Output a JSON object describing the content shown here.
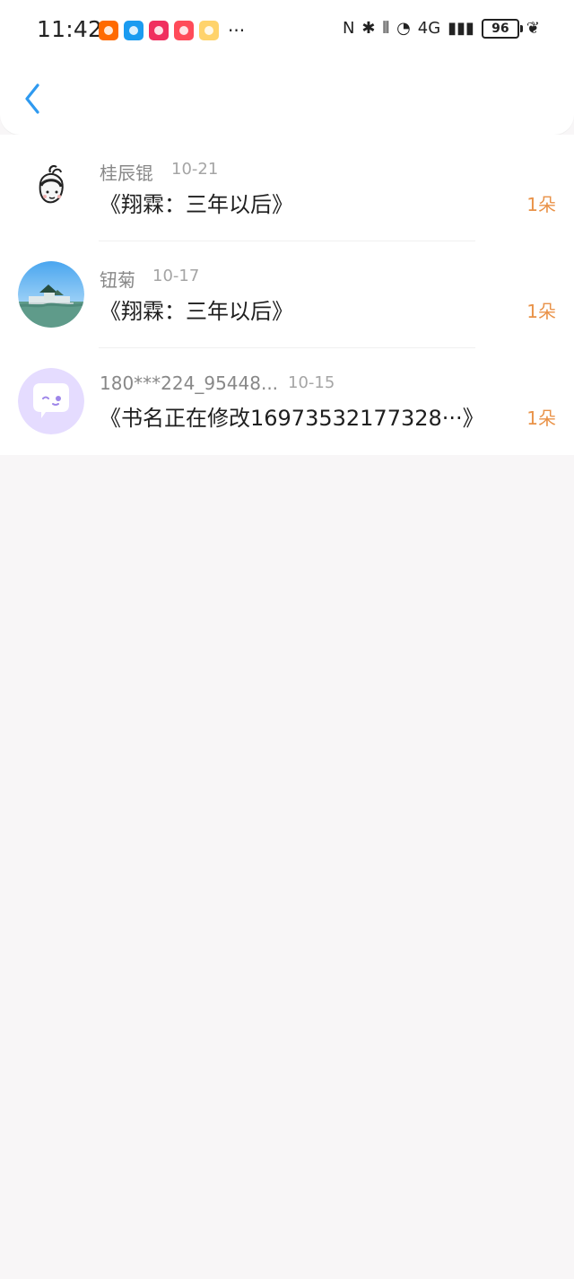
{
  "status_bar": {
    "time": "11:42",
    "more": "···",
    "battery": "96",
    "network": "4G"
  },
  "colors": {
    "accent_blue": "#2f9af0",
    "count_orange": "#e99248",
    "page_bg": "#f8f6f7"
  },
  "icons": {
    "back": "chevron-left-icon"
  },
  "items": [
    {
      "name": "桂辰锟",
      "date": "10-21",
      "book": "《翔霖：三年以后》",
      "count": "1朵"
    },
    {
      "name": "钮菊",
      "date": "10-17",
      "book": "《翔霖：三年以后》",
      "count": "1朵"
    },
    {
      "name": "180***224_95448...",
      "date": "10-15",
      "book": "《书名正在修改16973532177328···》",
      "count": "1朵"
    }
  ]
}
